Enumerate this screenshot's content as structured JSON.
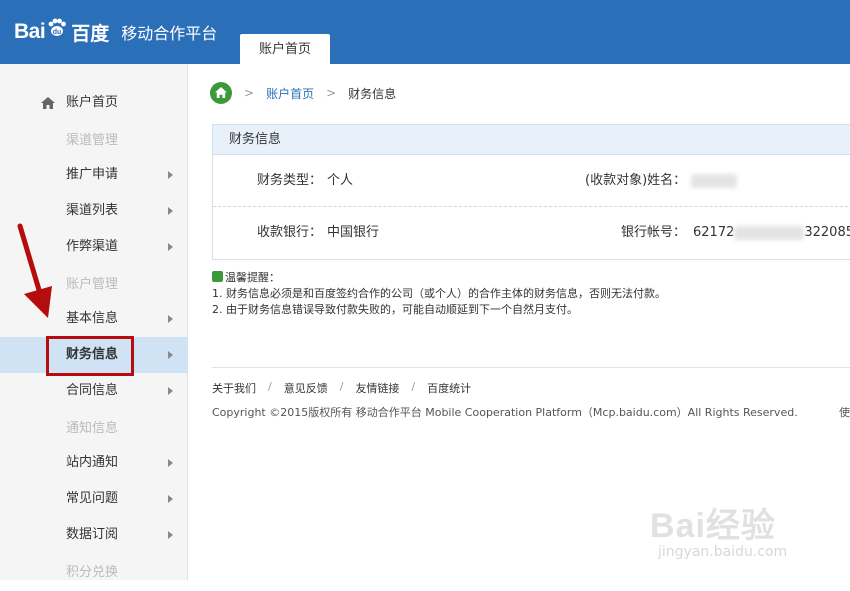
{
  "header": {
    "logo_text": "Bai",
    "logo_text2": "du",
    "logo_baidu": "百度",
    "logo_sub": "移动合作平台",
    "active_tab": "账户首页"
  },
  "sidebar": {
    "home": "账户首页",
    "groups": [
      "渠道管理",
      "账户管理",
      "通知信息",
      "积分兑换"
    ],
    "items": [
      "推广申请",
      "渠道列表",
      "作弊渠道",
      "基本信息",
      "财务信息",
      "合同信息",
      "站内通知",
      "常见问题",
      "数据订阅"
    ]
  },
  "breadcrumb": {
    "link": "账户首页",
    "current": "财务信息",
    "separator": ">"
  },
  "panel": {
    "title": "财务信息",
    "type_label": "财务类型：",
    "type_value": "个人",
    "name_label": "(收款对象)姓名：",
    "name_value": "",
    "bank_label": "收款银行：",
    "bank_value": "中国银行",
    "account_label": "银行帐号：",
    "account_prefix": "62172",
    "account_suffix": "322085"
  },
  "tips": {
    "title": "温馨提醒：",
    "line1": "1. 财务信息必须是和百度签约合作的公司（或个人）的合作主体的财务信息，否则无法付款。",
    "line2": "2. 由于财务信息错误导致付款失败的，可能自动顺延到下一个自然月支付。"
  },
  "footer": {
    "links": [
      "关于我们",
      "意见反馈",
      "友情链接",
      "百度统计"
    ],
    "separator": "/",
    "copyright": "Copyright ©2015版权所有 移动合作平台 Mobile Cooperation Platform（Mcp.baidu.com）All Rights Reserved.",
    "trail": "使"
  },
  "watermark": {
    "text": "Bai经验",
    "url": "jingyan.baidu.com"
  },
  "colors": {
    "header_bg": "#2a6fb8",
    "active_item_bg": "#cfe3f4",
    "annotation": "#b50d0d",
    "home_green": "#3a9a3a"
  }
}
